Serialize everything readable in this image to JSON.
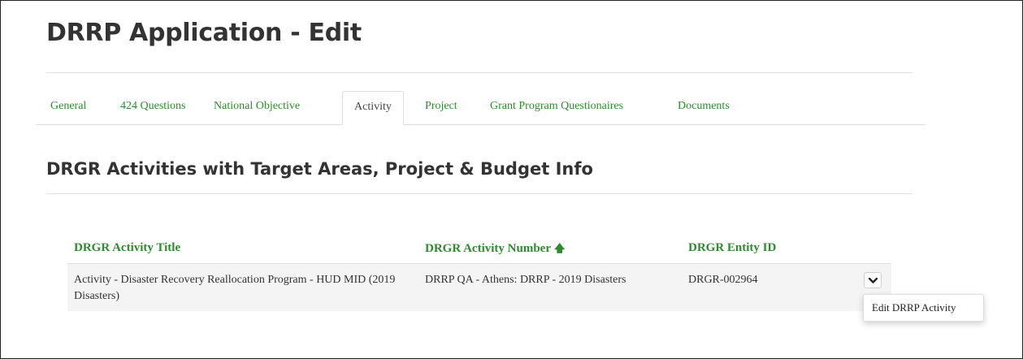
{
  "page": {
    "title": "DRRP Application - Edit"
  },
  "tabs": [
    {
      "label": "General",
      "active": false
    },
    {
      "label": "424 Questions",
      "active": false
    },
    {
      "label": "National Objective",
      "active": false
    },
    {
      "label": "Activity",
      "active": true
    },
    {
      "label": "Project",
      "active": false
    },
    {
      "label": "Grant Program Questionaires",
      "active": false
    },
    {
      "label": "Documents",
      "active": false
    }
  ],
  "section": {
    "title": "DRGR Activities with Target Areas, Project & Budget Info"
  },
  "table": {
    "columns": [
      "DRGR Activity Title",
      "DRGR Activity Number",
      "DRGR Entity ID"
    ],
    "sort": {
      "column": "DRGR Activity Number",
      "direction": "ascending",
      "icon": "arrow-up-icon"
    },
    "rows": [
      {
        "title": "Activity - Disaster Recovery Reallocation Program - HUD MID (2019 Disasters)",
        "number": "DRRP QA - Athens: DRRP - 2019 Disasters",
        "entity_id": "DRGR-002964"
      }
    ]
  },
  "row_menu": {
    "toggle_icon": "chevron-down-icon",
    "items": [
      "Edit DRRP Activity"
    ]
  },
  "colors": {
    "accent": "#2e8b2e",
    "text": "#333333",
    "row_bg": "#f4f4f4"
  }
}
